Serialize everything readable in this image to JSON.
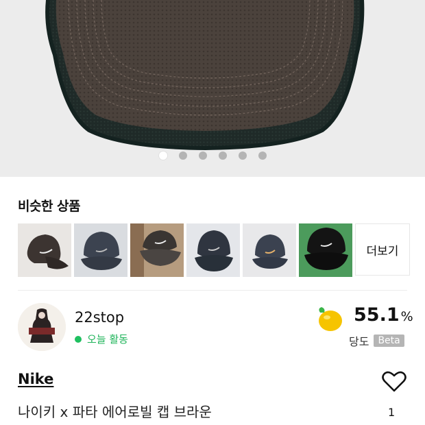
{
  "gallery": {
    "dot_count": 6,
    "active_index": 0
  },
  "similar": {
    "title": "비슷한 상품",
    "more_label": "더보기",
    "thumbnails": [
      {
        "icon": "brown-cap"
      },
      {
        "icon": "grey-cap"
      },
      {
        "icon": "brown-cap-worn"
      },
      {
        "icon": "grey-cap"
      },
      {
        "icon": "grey-cap"
      },
      {
        "icon": "black-cap"
      }
    ]
  },
  "seller": {
    "name": "22stop",
    "activity": "오늘 활동",
    "activity_color": "#1fc060",
    "score_value": "55.1",
    "score_unit": "%",
    "score_label": "당도",
    "beta_label": "Beta",
    "score_icon": "lemon-icon"
  },
  "product": {
    "brand": "Nike",
    "title": "나이키 x 파타 에어로빌 캡 브라운",
    "like_count": "1",
    "like_icon": "heart-icon"
  }
}
